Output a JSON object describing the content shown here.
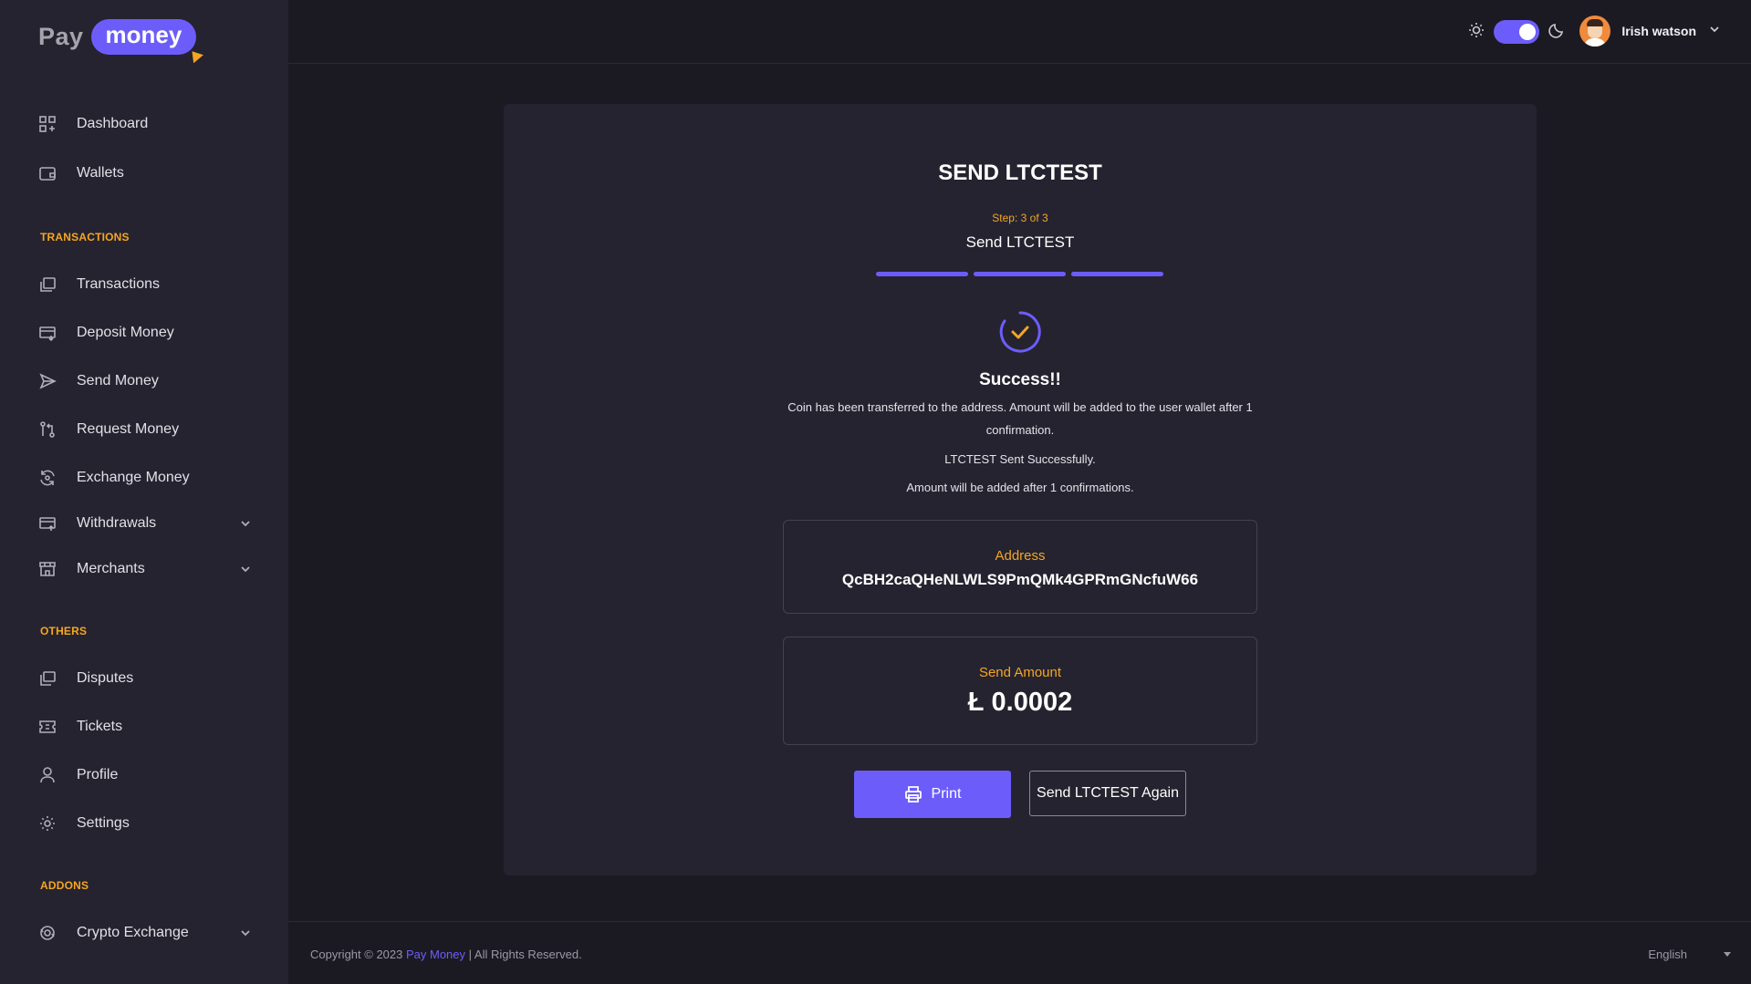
{
  "app": {
    "logo_left": "Pay",
    "logo_right": "money"
  },
  "sidebar": {
    "items": [
      {
        "label": "Dashboard",
        "icon": "dashboard-icon"
      },
      {
        "label": "Wallets",
        "icon": "wallet-icon"
      }
    ],
    "sections": [
      {
        "label": "TRANSACTIONS",
        "items": [
          {
            "label": "Transactions",
            "icon": "transactions-icon"
          },
          {
            "label": "Deposit Money",
            "icon": "deposit-icon"
          },
          {
            "label": "Send Money",
            "icon": "send-icon"
          },
          {
            "label": "Request Money",
            "icon": "request-icon"
          },
          {
            "label": "Exchange Money",
            "icon": "exchange-icon"
          },
          {
            "label": "Withdrawals",
            "icon": "withdrawals-icon"
          },
          {
            "label": "Merchants",
            "icon": "merchants-icon"
          }
        ]
      },
      {
        "label": "OTHERS",
        "items": [
          {
            "label": "Disputes",
            "icon": "disputes-icon"
          },
          {
            "label": "Tickets",
            "icon": "tickets-icon"
          },
          {
            "label": "Profile",
            "icon": "profile-icon"
          },
          {
            "label": "Settings",
            "icon": "settings-icon"
          }
        ]
      },
      {
        "label": "ADDONS",
        "items": [
          {
            "label": "Crypto Exchange",
            "icon": "crypto-exchange-icon"
          }
        ]
      }
    ]
  },
  "header": {
    "user_name": "Irish watson",
    "theme": "dark"
  },
  "main": {
    "title": "SEND LTCTEST",
    "step_label": "Step: 3 of 3",
    "step_subtitle": "Send LTCTEST",
    "steps_completed": 3,
    "steps_total": 3,
    "success_title": "Success!!",
    "message_1": "Coin has been transferred to the address. Amount will be added to the user wallet after 1 confirmation.",
    "message_2": "LTCTEST Sent Successfully.",
    "message_3": "Amount will be added after 1 confirmations.",
    "address_label": "Address",
    "address_value": "QcBH2caQHeNLWLS9PmQMk4GPRmGNcfuW66",
    "amount_label": "Send Amount",
    "amount_value": "Ł 0.0002",
    "print_button": "Print",
    "send_again_button": "Send LTCTEST Again"
  },
  "footer": {
    "copyright_prefix": "Copyright © 2023 ",
    "brand": "Pay Money",
    "copyright_suffix": " | All Rights Reserved.",
    "language": "English"
  },
  "colors": {
    "accent": "#6c5dfb",
    "highlight": "#f5a623",
    "background": "#1b1a22",
    "panel": "#25232f"
  }
}
